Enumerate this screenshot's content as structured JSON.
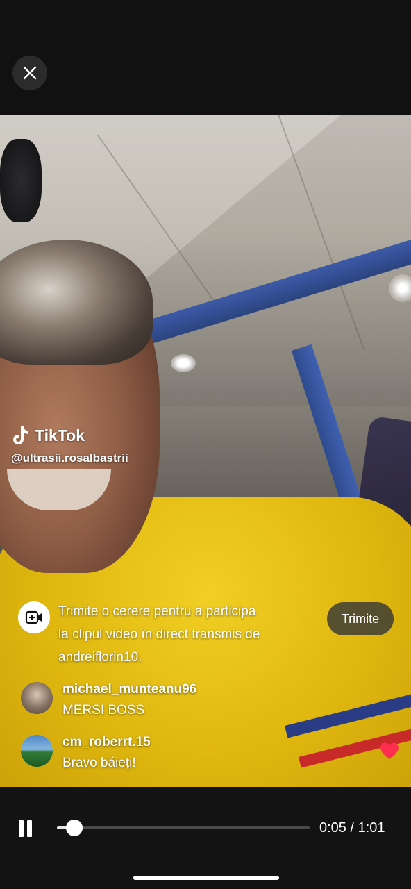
{
  "top_bar": {
    "close_icon": "close-icon"
  },
  "video": {
    "watermark": {
      "brand": "TikTok",
      "handle": "@ultrasii.rosalbastrii"
    },
    "join_request": {
      "icon": "add-video-icon",
      "line1": "Trimite o cerere pentru a participa",
      "line2": "la clipul video în direct transmis de",
      "line3": "andreiflorin10.",
      "button_label": "Trimite"
    },
    "comments": [
      {
        "username": "michael_munteanu96",
        "text": "MERSI BOSS"
      },
      {
        "username": "cm_roberrt.15",
        "text": "Bravo băieți!"
      }
    ],
    "reaction_icon": "heart-icon"
  },
  "player": {
    "state": "playing",
    "current_time": "0:05",
    "duration": "1:01",
    "time_text": "0:05 / 1:01",
    "progress": 0.07,
    "accent_color": "#ffffff"
  }
}
